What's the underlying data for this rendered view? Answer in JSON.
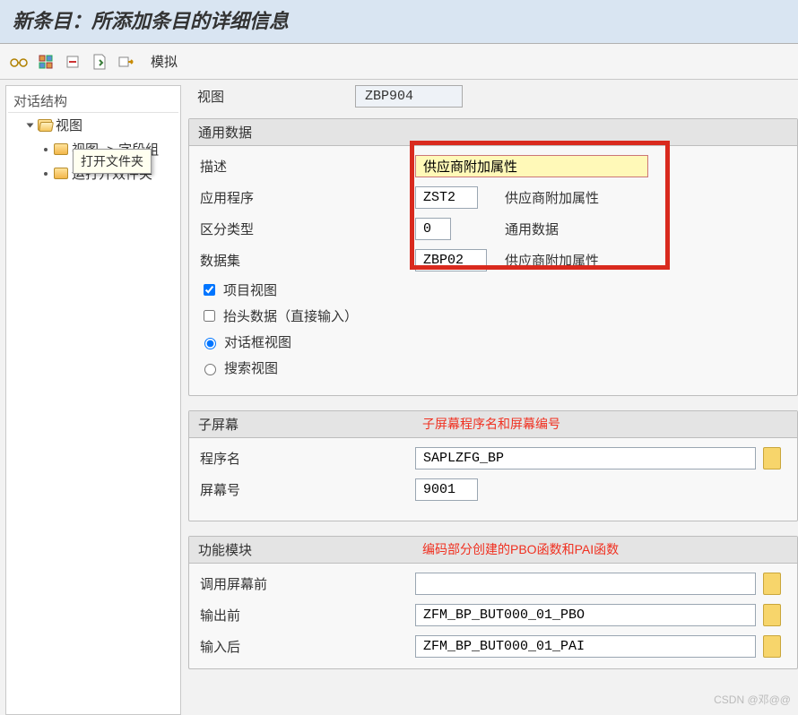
{
  "title": "新条目：所添加条目的详细信息",
  "toolbar": {
    "simulate": "模拟"
  },
  "tree": {
    "header": "对话结构",
    "root": "视图",
    "child1": "视图 -> 字段组",
    "child2": "运打开效件夹",
    "tooltip": "打开文件夹"
  },
  "top": {
    "view_label": "视图",
    "view_value": "ZBP904"
  },
  "general": {
    "legend": "通用数据",
    "desc_label": "描述",
    "desc_value": "供应商附加属性",
    "app_label": "应用程序",
    "app_value": "ZST2",
    "app_text": "供应商附加属性",
    "diff_label": "区分类型",
    "diff_value": "0",
    "diff_text": "通用数据",
    "dataset_label": "数据集",
    "dataset_value": "ZBP02",
    "dataset_text": "供应商附加属性",
    "chk_item_view": "项目视图",
    "chk_header": "抬头数据（直接输入）",
    "rad_dialog": "对话框视图",
    "rad_search": "搜索视图"
  },
  "subscreen": {
    "legend": "子屏幕",
    "annotation": "子屏幕程序名和屏幕编号",
    "prog_label": "程序名",
    "prog_value": "SAPLZFG_BP",
    "scr_label": "屏幕号",
    "scr_value": "9001"
  },
  "fm": {
    "legend": "功能模块",
    "annotation": "编码部分创建的PBO函数和PAI函数",
    "before_call_label": "调用屏幕前",
    "before_call_value": "",
    "before_out_label": "输出前",
    "before_out_value": "ZFM_BP_BUT000_01_PBO",
    "after_in_label": "输入后",
    "after_in_value": "ZFM_BP_BUT000_01_PAI"
  },
  "watermark": "CSDN @邓@@"
}
